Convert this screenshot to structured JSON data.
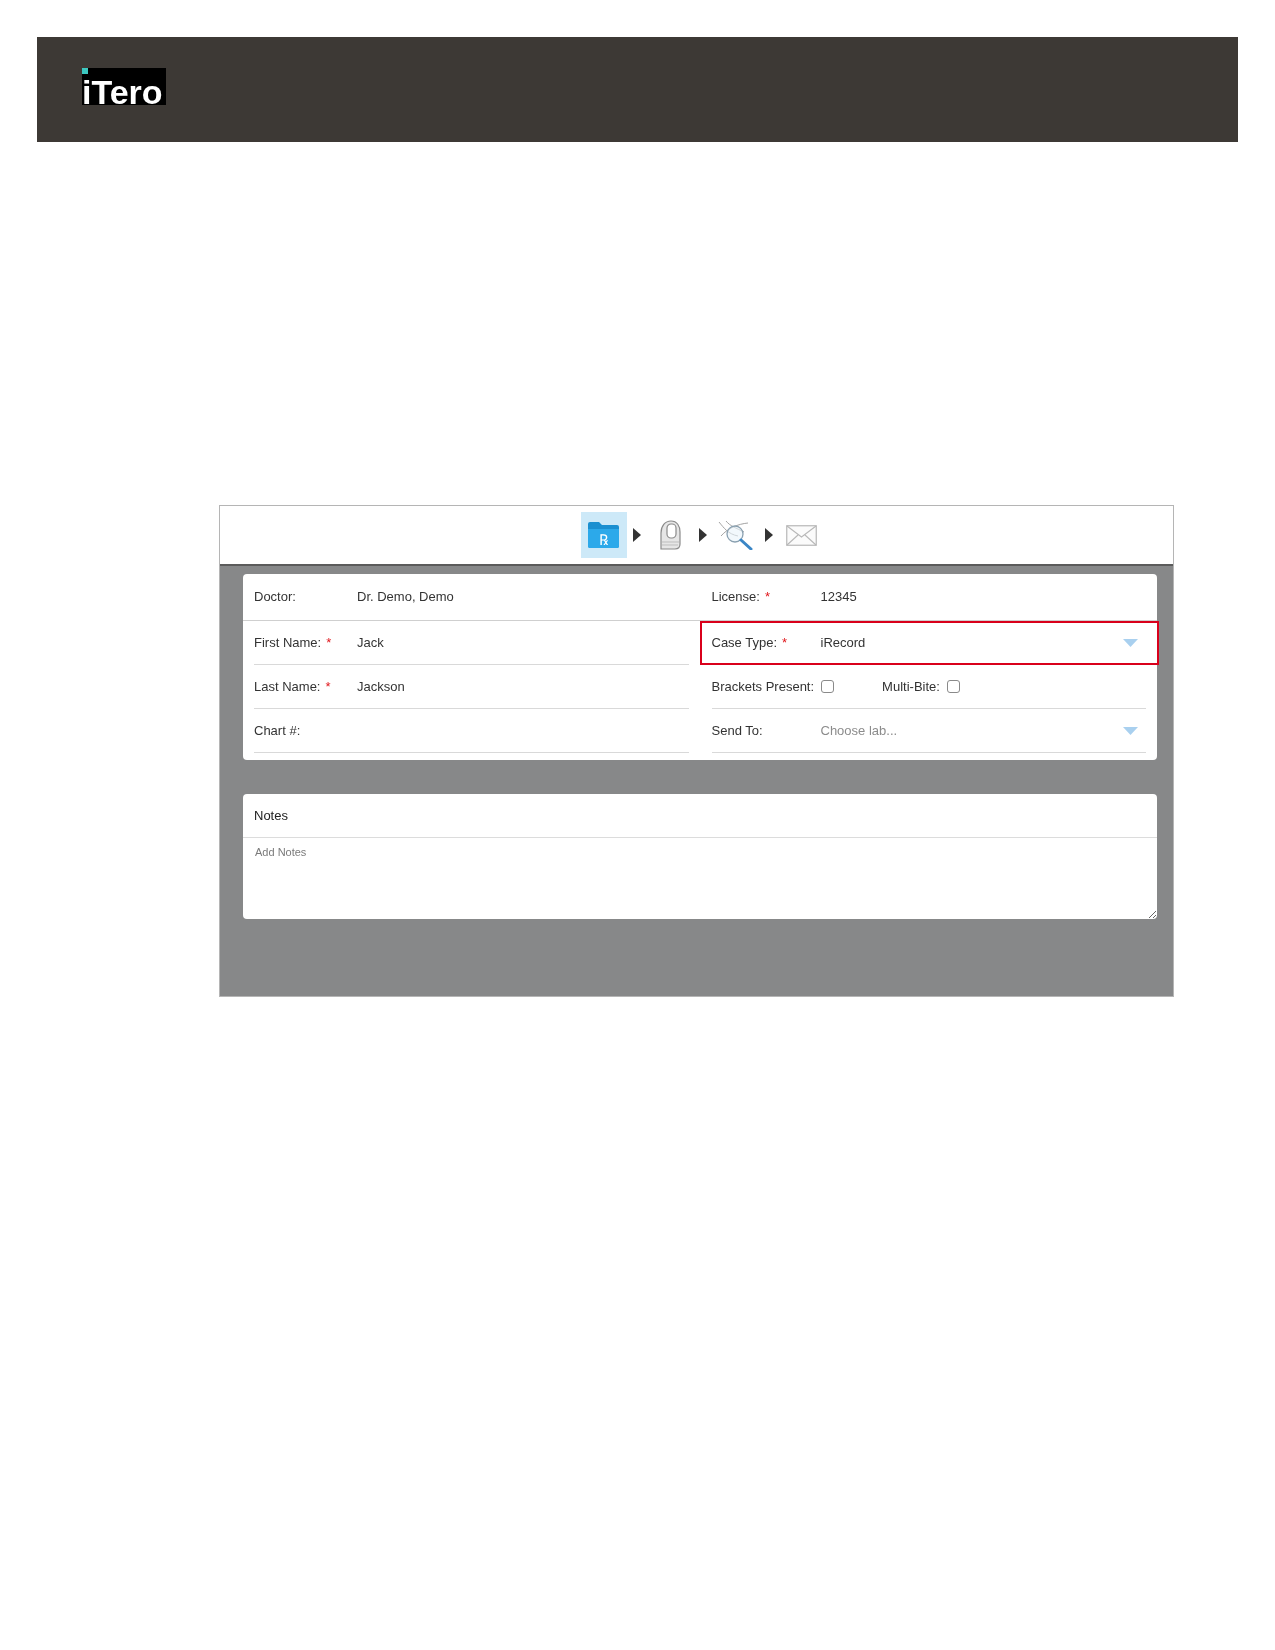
{
  "header": {
    "logo": "iTero"
  },
  "workflow": {
    "steps": [
      {
        "kind": "prescription",
        "symbol": "℞",
        "selected": true
      },
      {
        "kind": "scan",
        "selected": false
      },
      {
        "kind": "view",
        "selected": false
      },
      {
        "kind": "send",
        "selected": false
      }
    ]
  },
  "patient_form": {
    "top_row": [
      {
        "label": "Doctor:",
        "value": "Dr. Demo, Demo"
      },
      {
        "label": "License:",
        "required_mark": "*",
        "value": "12345"
      }
    ],
    "left_fields": [
      {
        "kind": "text",
        "label": "First Name:",
        "required_mark": "*",
        "value": "Jack"
      },
      {
        "kind": "text",
        "label": "Last Name:",
        "required_mark": "*",
        "value": "Jackson"
      },
      {
        "kind": "text",
        "label": "Chart #:"
      }
    ],
    "right_fields": [
      {
        "kind": "select",
        "label": "Case Type:",
        "required_mark": "*",
        "value": "iRecord",
        "highlighted": true
      },
      {
        "kind": "checkboxes",
        "highlighted": false,
        "options": [
          {
            "label": "Brackets Present:",
            "checked": false
          },
          {
            "label": "Multi-Bite:",
            "checked": false
          }
        ]
      },
      {
        "kind": "select",
        "label": "Send To:",
        "placeholder": "Choose lab...",
        "highlighted": false
      }
    ]
  },
  "notes": {
    "title": "Notes",
    "placeholder": "Add Notes"
  }
}
